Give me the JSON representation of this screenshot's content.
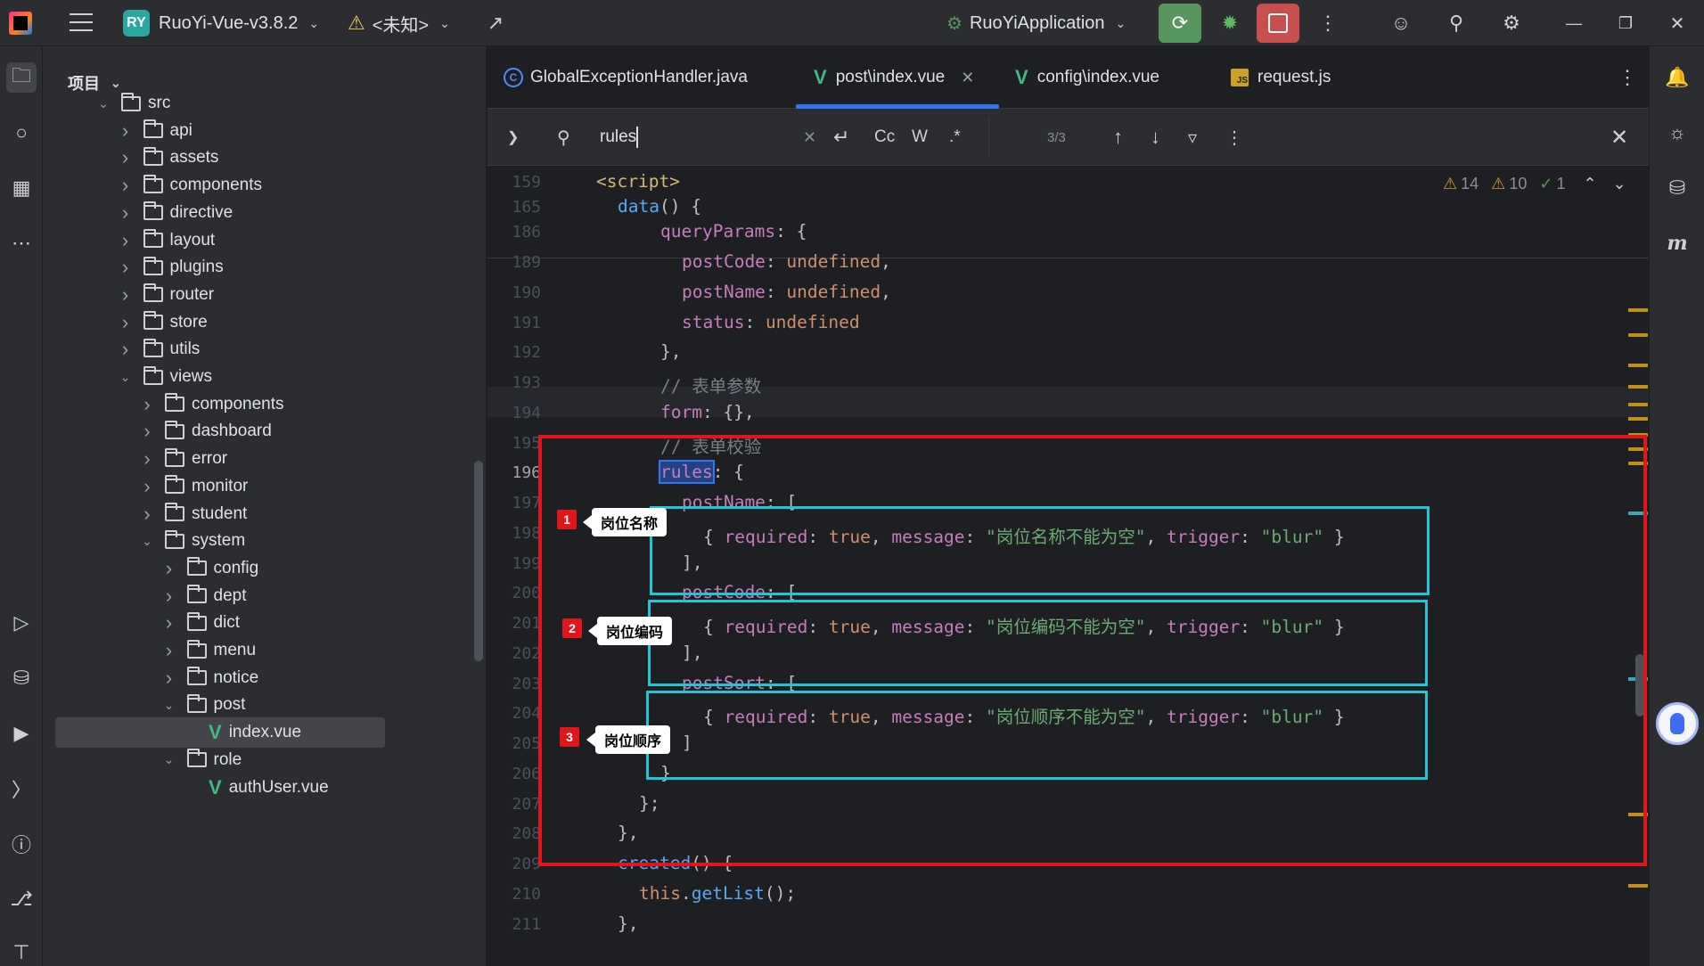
{
  "titlebar": {
    "project_badge": "RY",
    "project_name": "RuoYi-Vue-v3.8.2",
    "vcs_status": "<未知>",
    "run_config": "RuoYiApplication"
  },
  "project_panel": {
    "title": "项目",
    "tree": [
      {
        "label": "src",
        "depth": 0,
        "type": "folder",
        "expanded": true
      },
      {
        "label": "api",
        "depth": 1,
        "type": "folder",
        "expanded": false
      },
      {
        "label": "assets",
        "depth": 1,
        "type": "folder",
        "expanded": false
      },
      {
        "label": "components",
        "depth": 1,
        "type": "folder",
        "expanded": false
      },
      {
        "label": "directive",
        "depth": 1,
        "type": "folder",
        "expanded": false
      },
      {
        "label": "layout",
        "depth": 1,
        "type": "folder",
        "expanded": false
      },
      {
        "label": "plugins",
        "depth": 1,
        "type": "folder",
        "expanded": false
      },
      {
        "label": "router",
        "depth": 1,
        "type": "folder",
        "expanded": false
      },
      {
        "label": "store",
        "depth": 1,
        "type": "folder",
        "expanded": false
      },
      {
        "label": "utils",
        "depth": 1,
        "type": "folder",
        "expanded": false
      },
      {
        "label": "views",
        "depth": 1,
        "type": "folder",
        "expanded": true
      },
      {
        "label": "components",
        "depth": 2,
        "type": "folder",
        "expanded": false
      },
      {
        "label": "dashboard",
        "depth": 2,
        "type": "folder",
        "expanded": false
      },
      {
        "label": "error",
        "depth": 2,
        "type": "folder",
        "expanded": false
      },
      {
        "label": "monitor",
        "depth": 2,
        "type": "folder",
        "expanded": false
      },
      {
        "label": "student",
        "depth": 2,
        "type": "folder",
        "expanded": false
      },
      {
        "label": "system",
        "depth": 2,
        "type": "folder",
        "expanded": true
      },
      {
        "label": "config",
        "depth": 3,
        "type": "folder",
        "expanded": false
      },
      {
        "label": "dept",
        "depth": 3,
        "type": "folder",
        "expanded": false
      },
      {
        "label": "dict",
        "depth": 3,
        "type": "folder",
        "expanded": false
      },
      {
        "label": "menu",
        "depth": 3,
        "type": "folder",
        "expanded": false
      },
      {
        "label": "notice",
        "depth": 3,
        "type": "folder",
        "expanded": false
      },
      {
        "label": "post",
        "depth": 3,
        "type": "folder",
        "expanded": true
      },
      {
        "label": "index.vue",
        "depth": 4,
        "type": "vue",
        "selected": true
      },
      {
        "label": "role",
        "depth": 3,
        "type": "folder",
        "expanded": true
      },
      {
        "label": "authUser.vue",
        "depth": 4,
        "type": "vue"
      }
    ]
  },
  "tabs": [
    {
      "label": "GlobalExceptionHandler.java",
      "icon": "java-class-icon"
    },
    {
      "label": "post\\index.vue",
      "icon": "vue-icon",
      "active": true
    },
    {
      "label": "config\\index.vue",
      "icon": "vue-icon"
    },
    {
      "label": "request.js",
      "icon": "js-icon"
    }
  ],
  "search": {
    "query": "rules",
    "match_case": "Cc",
    "words": "W",
    "regex": ".*",
    "count": "3/3"
  },
  "inspections": {
    "warnings_a": "14",
    "warnings_b": "10",
    "ok": "1"
  },
  "code": {
    "lines": [
      "159",
      "165",
      "186",
      "189",
      "190",
      "191",
      "192",
      "193",
      "194",
      "195",
      "196",
      "197",
      "198",
      "199",
      "200",
      "201",
      "202",
      "203",
      "204",
      "205",
      "206",
      "207",
      "208",
      "209",
      "210",
      "211"
    ],
    "comment_params": "// 表单参数",
    "comment_rules": "// 表单校验",
    "msg_name": "\"岗位名称不能为空\"",
    "msg_code": "\"岗位编码不能为空\"",
    "msg_sort": "\"岗位顺序不能为空\""
  },
  "annotations": [
    {
      "number": "1",
      "label": "岗位名称"
    },
    {
      "number": "2",
      "label": "岗位编码"
    },
    {
      "number": "3",
      "label": "岗位顺序"
    }
  ],
  "colors": {
    "annotation_red": "#e0161a",
    "annotation_cyan": "#1ec6d6",
    "accent": "#3574f0"
  }
}
